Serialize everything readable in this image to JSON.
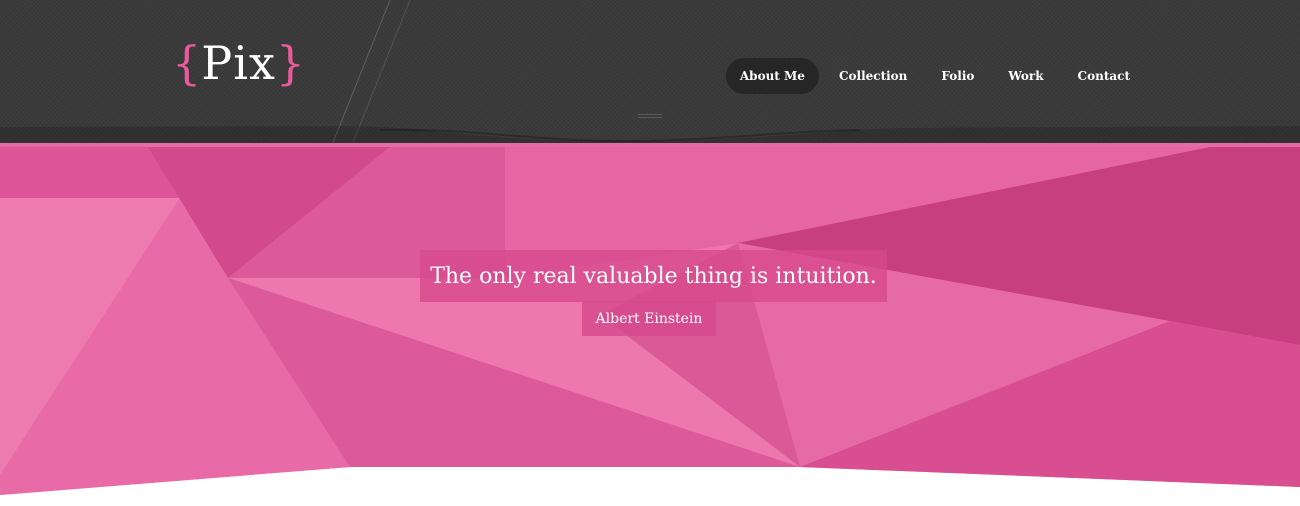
{
  "brand": {
    "open_brace": "{",
    "name": "Pix",
    "close_brace": "}"
  },
  "nav": {
    "items": [
      {
        "label": "About Me",
        "active": true
      },
      {
        "label": "Collection",
        "active": false
      },
      {
        "label": "Folio",
        "active": false
      },
      {
        "label": "Work",
        "active": false
      },
      {
        "label": "Contact",
        "active": false
      }
    ]
  },
  "hero": {
    "quote": "The only real valuable thing is intuition.",
    "author": "Albert Einstein"
  },
  "colors": {
    "accent": "#ea5b9d",
    "header_bg": "#3a3a3a",
    "active_nav_bg": "#262626",
    "hero_pink": "#e2609e"
  },
  "icons": {
    "menu_handle": "menu-handle-icon"
  }
}
